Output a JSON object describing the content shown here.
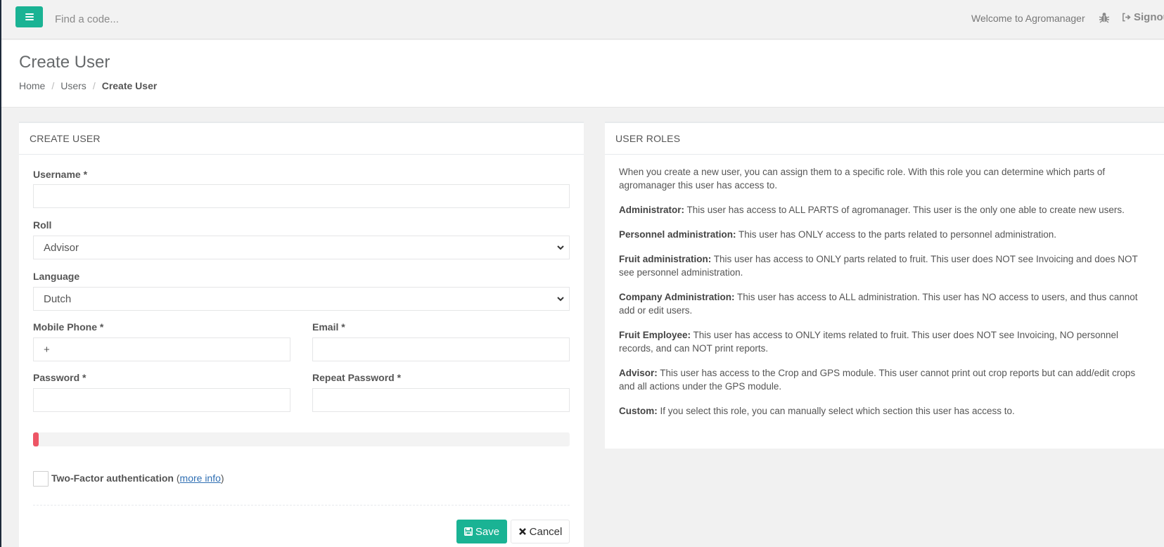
{
  "topbar": {
    "search_placeholder": "Find a code...",
    "welcome_text": "Welcome to Agromanager",
    "signout_label": "Signou"
  },
  "heading": {
    "title": "Create User",
    "breadcrumb": [
      {
        "label": "Home"
      },
      {
        "label": "Users"
      },
      {
        "label": "Create User"
      }
    ]
  },
  "form": {
    "panel_title": "CREATE USER",
    "username_label": "Username *",
    "username_value": "",
    "roll_label": "Roll",
    "roll_selected": "Advisor",
    "language_label": "Language",
    "language_selected": "Dutch",
    "mobile_label": "Mobile Phone *",
    "mobile_value": "+",
    "email_label": "Email *",
    "email_value": "",
    "password_label": "Password *",
    "password_value": "",
    "repeat_password_label": "Repeat Password *",
    "repeat_password_value": "",
    "password_strength_percent": 1,
    "twofa_checked": false,
    "twofa_label": "Two-Factor authentication",
    "twofa_open_paren": "(",
    "twofa_link": "more info",
    "twofa_close_paren": ")",
    "save_label": "Save",
    "cancel_label": "Cancel"
  },
  "roles": {
    "panel_title": "USER ROLES",
    "intro": "When you create a new user, you can assign them to a specific role. With this role you can determine which parts of agromanager this user has access to.",
    "items": [
      {
        "name": "Administrator:",
        "desc": "This user has access to ALL PARTS of agromanager. This user is the only one able to create new users."
      },
      {
        "name": "Personnel administration:",
        "desc": "This user has ONLY access to the parts related to personnel administration."
      },
      {
        "name": "Fruit administration:",
        "desc": "This user has access to ONLY parts related to fruit. This user does NOT see Invoicing and does NOT see personnel administration."
      },
      {
        "name": "Company Administration:",
        "desc": "This user has access to ALL administration. This user has NO access to users, and thus cannot add or edit users."
      },
      {
        "name": "Fruit Employee:",
        "desc": "This user has access to ONLY items related to fruit. This user does NOT see Invoicing, NO personnel records, and can NOT print reports."
      },
      {
        "name": "Advisor:",
        "desc": "This user has access to the Crop and GPS module. This user cannot print out crop reports but can add/edit crops and all actions under the GPS module."
      },
      {
        "name": "Custom:",
        "desc": "If you select this role, you can manually select which section this user has access to."
      }
    ]
  },
  "colors": {
    "accent": "#1ab394",
    "danger": "#ed5565"
  }
}
